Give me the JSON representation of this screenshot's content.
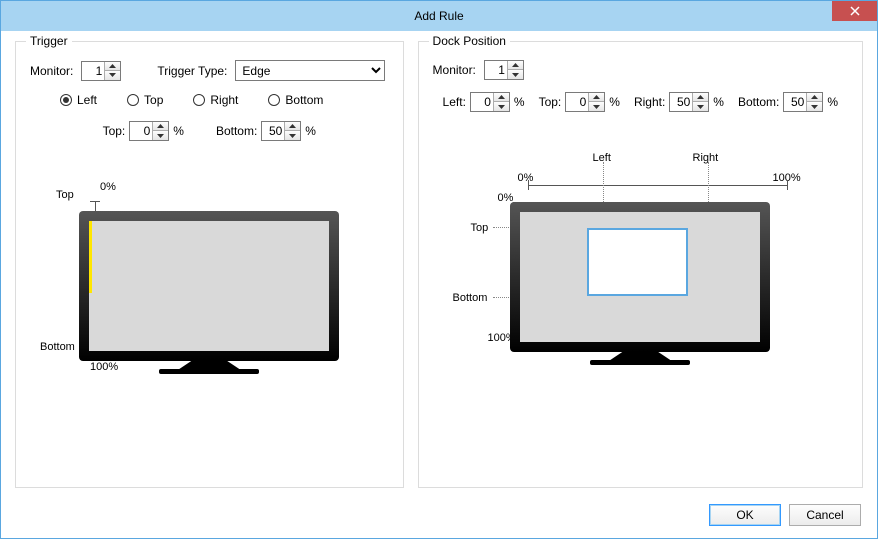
{
  "window": {
    "title": "Add Rule"
  },
  "buttons": {
    "ok": "OK",
    "cancel": "Cancel"
  },
  "trigger": {
    "legend": "Trigger",
    "monitor_label": "Monitor:",
    "monitor_value": "1",
    "type_label": "Trigger Type:",
    "type_value": "Edge",
    "radios": {
      "left": "Left",
      "top": "Top",
      "right": "Right",
      "bottom": "Bottom"
    },
    "selected_edge": "left",
    "top_label": "Top:",
    "top_value": "0",
    "bottom_label": "Bottom:",
    "bottom_value": "50",
    "pct": "%",
    "fig": {
      "top": "Top",
      "bottom": "Bottom",
      "zero": "0%",
      "hundred": "100%"
    }
  },
  "dock": {
    "legend": "Dock Position",
    "monitor_label": "Monitor:",
    "monitor_value": "1",
    "left_label": "Left:",
    "left_value": "0",
    "top_label": "Top:",
    "top_value": "0",
    "right_label": "Right:",
    "right_value": "50",
    "bottom_label": "Bottom:",
    "bottom_value": "50",
    "pct": "%",
    "fig": {
      "left": "Left",
      "right": "Right",
      "top": "Top",
      "bottom": "Bottom",
      "zero": "0%",
      "hundred": "100%"
    }
  }
}
